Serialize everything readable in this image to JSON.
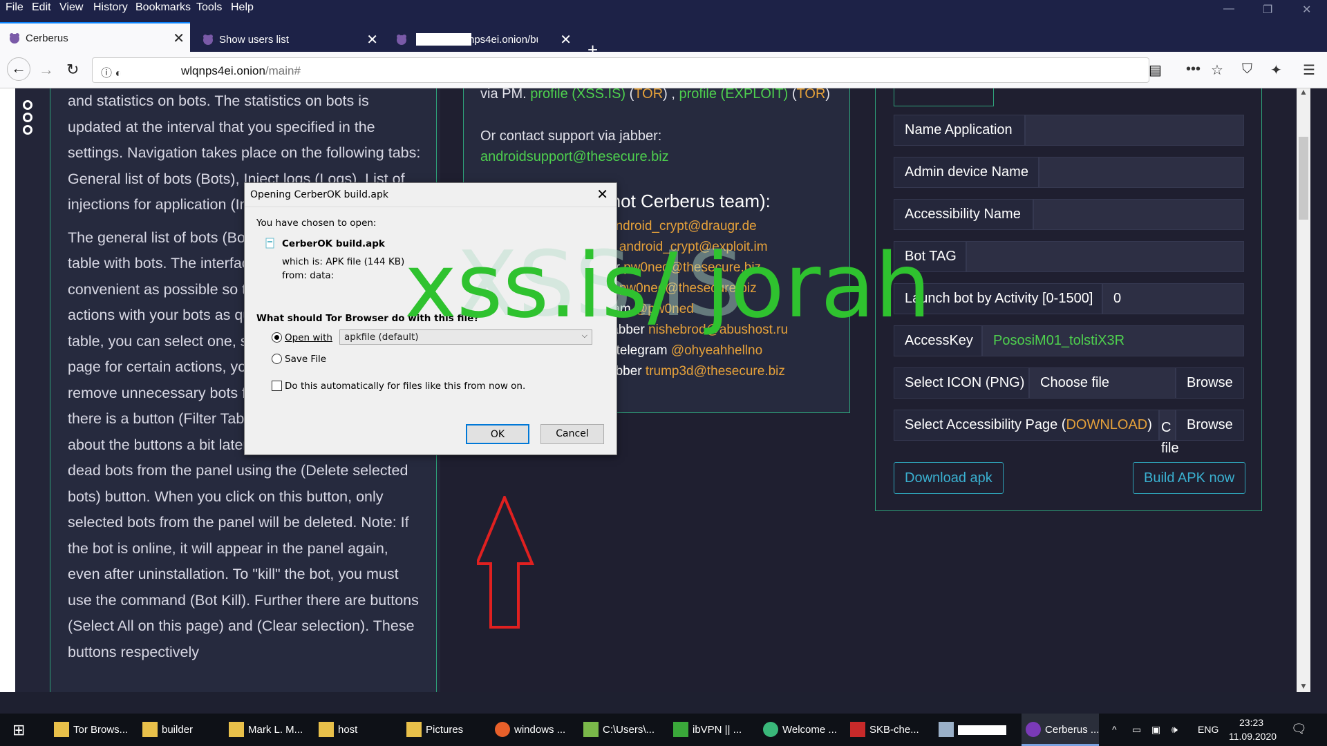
{
  "menubar": {
    "items": [
      "File",
      "Edit",
      "View",
      "History",
      "Bookmarks",
      "Tools",
      "Help"
    ]
  },
  "tabs": [
    {
      "label": "Cerberus",
      "close": "✕"
    },
    {
      "label": "Show users list",
      "close": "✕"
    },
    {
      "label": "nps4ei.onion/builde",
      "close": "✕"
    }
  ],
  "address": {
    "host": "wlqnps4ei.onion",
    "path": "/main#"
  },
  "help": {
    "para1": "and statistics on bots. The statistics on bots is updated at the interval that you specified in the settings. Navigation takes place on the following tabs: General list of bots (Bots), Inject logs (Logs), List of injections for application (Injects), Settings (Settings).",
    "para2": "The general list of bots (Bots) Here you will see a table with bots. The interface is designed as convenient as possible so that you can perform actions with your bots as quickly as possible. In the table, you can select one, several or all bots on the page for certain actions, you can also refresh or remove unnecessary bots from the list. For filtering, there is a button (Filter Table). We will tell you more about the buttons a bit later. You can also remove dead bots from the panel using the (Delete selected bots) button. When you click on this button, only selected bots from the panel will be deleted. Note: If the bot is online, it will appear in the panel again, even after uninstallation. To \"kill\" the bot, you must use the command (Bot Kill). Further there are buttons (Select All on this page) and (Clear selection). These buttons respectively"
  },
  "contacts": {
    "pm_prefix": "via PM.",
    "profile_xss": "profile (XSS.IS)",
    "tor1": "TOR",
    "profile_exploit": "profile (EXPLOIT)",
    "tor2": "TOR",
    "jabber_intro": "Or contact support via jabber:",
    "jabber_support": "androidsupport@thesecure.biz",
    "heading": "(not Cerberus team):",
    "lines": [
      {
        "prefix": "",
        "value": "android_crypt@draugr.de"
      },
      {
        "prefix": "2",
        "value": "android_crypt@exploit.im"
      },
      {
        "prefix": "er",
        "value": "pw0ned@thesecure.biz"
      },
      {
        "prefix": "2",
        "value": "pw0ned@thesecure.biz"
      },
      {
        "prefix": "ram",
        "value": "@pw0ned"
      },
      {
        "prefix": "jabber",
        "value": "nishebrod@abushost.ru"
      },
      {
        "prefix": "- telegram",
        "value": "@ohyeahhellno"
      },
      {
        "prefix": "abber",
        "value": "trump3d@thesecure.biz"
      }
    ]
  },
  "builder": {
    "fields": [
      {
        "label": "Name Application",
        "value": ""
      },
      {
        "label": "Admin device Name",
        "value": ""
      },
      {
        "label": "Accessibility Name",
        "value": ""
      },
      {
        "label": "Bot TAG",
        "value": ""
      },
      {
        "label": "Launch bot by Activity [0-1500]",
        "value": "0"
      },
      {
        "label": "AccessKey",
        "value": "PososiM01_tolstiX3R"
      }
    ],
    "icon_label": "Select ICON (PNG)",
    "icon_file": "Choose file",
    "browse": "Browse",
    "acc_label_prefix": "Select Accessibility Page (",
    "acc_download": "DOWNLOAD",
    "acc_label_suffix": ")",
    "acc_file": "C file",
    "download_apk": "Download apk",
    "build_apk": "Build APK now"
  },
  "dialog": {
    "title": "Opening CerberOK build.apk",
    "chosen": "You have chosen to open:",
    "filename": "CerberOK build.apk",
    "which_is": "which is:  APK file (144 KB)",
    "from": "from:  data:",
    "question": "What should Tor Browser do with this file?",
    "open_with": "Open with",
    "app": "apkfile (default)",
    "save_file": "Save File",
    "auto": "Do this automatically for files like this from now on.",
    "ok": "OK",
    "cancel": "Cancel"
  },
  "watermark": {
    "main": "xss.is/ jorah",
    "ghost": "XSS.IS"
  },
  "taskbar": {
    "items": [
      {
        "label": "Tor Brows..."
      },
      {
        "label": "builder"
      },
      {
        "label": "Mark L. M..."
      },
      {
        "label": "host"
      },
      {
        "label": "Pictures"
      },
      {
        "label": "windows ..."
      },
      {
        "label": "C:\\Users\\..."
      },
      {
        "label": "ibVPN || ..."
      },
      {
        "label": "Welcome ..."
      },
      {
        "label": "SKB-che..."
      },
      {
        "label": ""
      },
      {
        "label": "Cerberus ..."
      }
    ],
    "lang": "ENG",
    "time": "23:23",
    "date": "11.09.2020"
  },
  "colors": {
    "accent_green": "#4ed04e",
    "link_orange": "#e7a23a",
    "panel_border": "#2ea27a",
    "watermark": "#2fc22f"
  }
}
